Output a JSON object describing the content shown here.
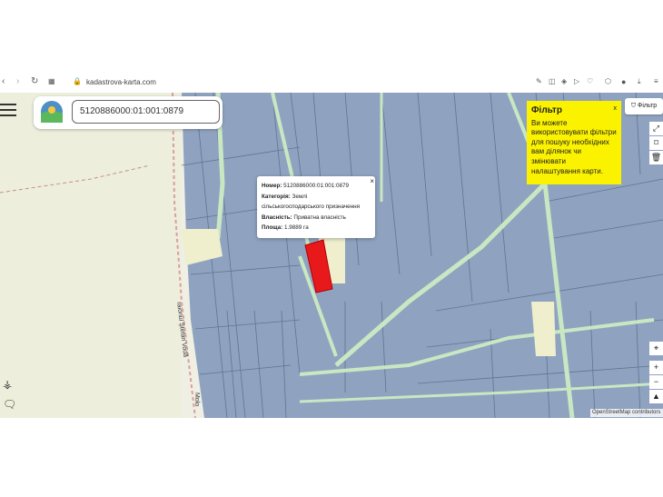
{
  "browser": {
    "url": "kadastrova-karta.com",
    "back_icon": "back-arrow-icon",
    "forward_icon": "forward-arrow-icon",
    "reload_icon": "reload-icon"
  },
  "search": {
    "value": "5120886000:01:001:0879"
  },
  "popup": {
    "number_label": "Номер:",
    "number_value": "5120886000:01:001:0879",
    "category_label": "Категорія:",
    "category_value": "Землі сільськогосподарського призначення",
    "ownership_label": "Власність:",
    "ownership_value": "Приватна власність",
    "area_label": "Площа:",
    "area_value": "1.9889 га",
    "close": "×"
  },
  "filter_tip": {
    "title": "Фільтр",
    "text": "Ви можете використовувати фільтри для пошуку необхідних вам ділянок чи змінювати налаштування карти.",
    "close": "x"
  },
  "filter_button": {
    "label": "Фільтр"
  },
  "map_labels": {
    "street1": "raionul Ştefan Vodă",
    "street2": "Molo"
  },
  "attribution": "OpenStreetMap contributors",
  "colors": {
    "parcel": "#8fa3c0",
    "parcel_border": "#5d7594",
    "highlight": "#e8191b",
    "road": "#c9e7c2",
    "tip": "#fbf200"
  }
}
